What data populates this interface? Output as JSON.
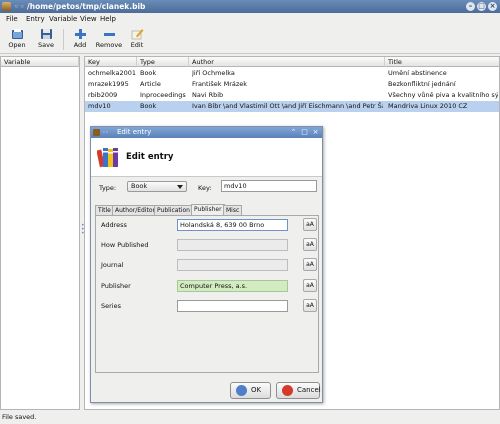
{
  "window": {
    "title": "/home/petos/tmp/clanek.bib"
  },
  "menubar": {
    "items": [
      "File",
      "Entry",
      "Variable",
      "View",
      "Help"
    ]
  },
  "toolbar": {
    "open": "Open",
    "save": "Save",
    "add": "Add",
    "remove": "Remove",
    "edit": "Edit"
  },
  "left_panel": {
    "header": "Variable"
  },
  "table": {
    "columns": [
      "Key",
      "Type",
      "Author",
      "Title"
    ],
    "rows": [
      {
        "key": "ochmelka2001",
        "type": "Book",
        "author": "Jiří Ochmelka",
        "title": "Umění abstinence"
      },
      {
        "key": "mrazek1995",
        "type": "Article",
        "author": "František Mrázek",
        "title": "Bezkonfliktní jednání"
      },
      {
        "key": "rbib2009",
        "type": "Inproceedings",
        "author": "Navi Rbib",
        "title": "Všechny vůně piva a kvalitního sýru"
      },
      {
        "key": "mdv10",
        "type": "Book",
        "author": "Ivan Bíbr \\and Vlastimil Ott \\and Jiří Eischmann \\and Petr Šafařík",
        "title": "Mandriva Linux 2010 CZ"
      }
    ]
  },
  "status": {
    "text": "File saved."
  },
  "dialog": {
    "title": "Edit entry",
    "heading": "Edit entry",
    "type_label": "Type:",
    "type_value": "Book",
    "key_label": "Key:",
    "key_value": "mdv10",
    "tabs": [
      "Title",
      "Author/Editor",
      "Publication",
      "Publisher",
      "Misc"
    ],
    "active_tab": "Publisher",
    "fields": [
      {
        "label": "Address",
        "value": "Holandská 8, 639 00 Brno"
      },
      {
        "label": "How Published",
        "value": ""
      },
      {
        "label": "Journal",
        "value": ""
      },
      {
        "label": "Publisher",
        "value": "Computer Press, a.s."
      },
      {
        "label": "Series",
        "value": ""
      }
    ],
    "aa_label": "aA",
    "ok_label": "OK",
    "cancel_label": "Cancel"
  },
  "colors": {
    "selection": "#b9d1ef",
    "titlebar": "#5577a6",
    "publisher_field": "#d3ebc0"
  }
}
